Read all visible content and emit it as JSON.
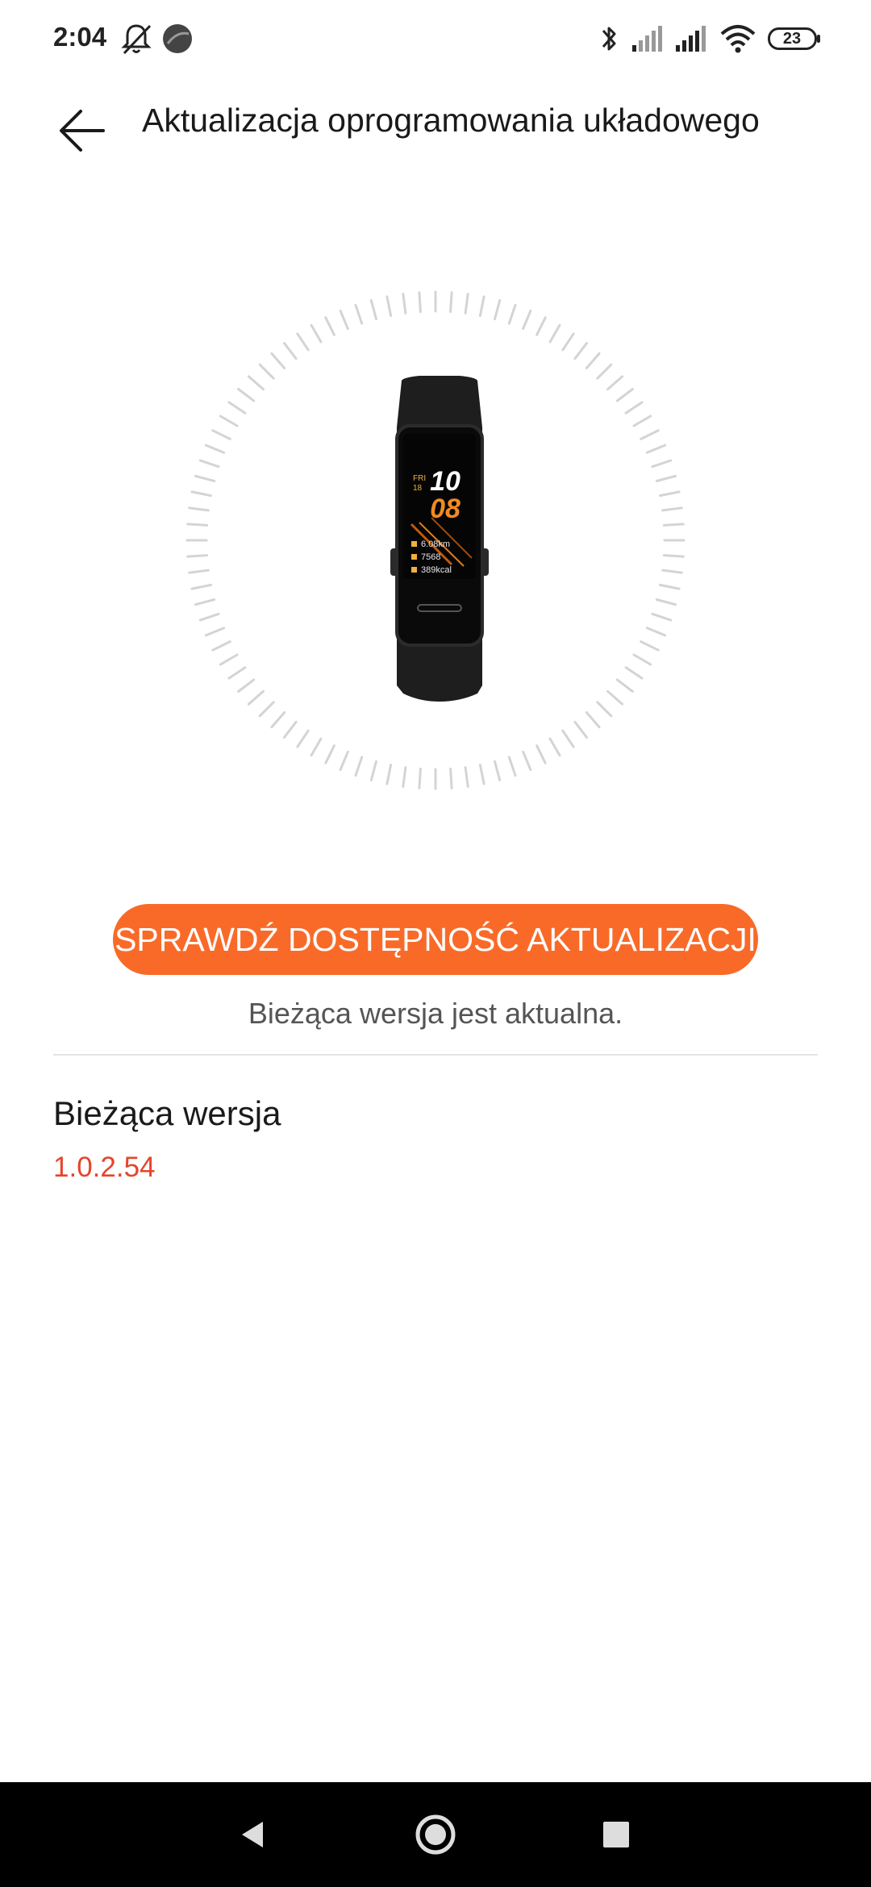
{
  "status_bar": {
    "time": "2:04",
    "battery": "23",
    "icons": [
      "notifications-off-icon",
      "circle-app-icon",
      "bluetooth-icon",
      "signal-icon",
      "signal-icon",
      "wifi-icon",
      "battery-icon"
    ]
  },
  "app_bar": {
    "back_icon": "arrow-left-icon",
    "title": "Aktualizacja oprogramowania układowego"
  },
  "device": {
    "screen": {
      "day": "FRI",
      "date": "18",
      "hour": "10",
      "minute": "08",
      "distance": "6.08km",
      "steps": "7568",
      "calories": "389kcal"
    }
  },
  "actions": {
    "check_button_label": "SPRAWDŹ DOSTĘPNOŚĆ AKTUALIZACJI",
    "status_message": "Bieżąca wersja jest aktualna."
  },
  "version": {
    "label": "Bieżąca wersja",
    "value": "1.0.2.54"
  },
  "colors": {
    "accent": "#f96a28",
    "version_value": "#e5452c"
  },
  "nav_bar": {
    "buttons": [
      "back-triangle-icon",
      "home-circle-icon",
      "recents-square-icon"
    ]
  }
}
